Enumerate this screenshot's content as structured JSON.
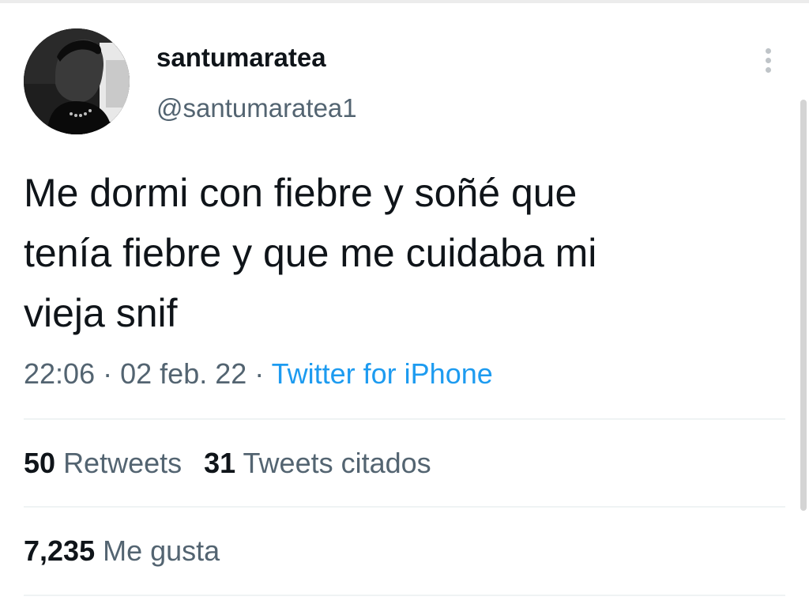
{
  "user": {
    "display_name": "santumaratea",
    "handle": "@santumaratea1"
  },
  "tweet": {
    "lines": [
      "Me dormi con fiebre y soñé que",
      "tenía fiebre y que me cuidaba mi",
      "vieja snif"
    ],
    "time": "22:06",
    "date": "02 feb. 22",
    "separator": "·",
    "source": "Twitter for iPhone"
  },
  "stats": {
    "retweets": {
      "count": "50",
      "label": "Retweets"
    },
    "quotes": {
      "count": "31",
      "label": "Tweets citados"
    },
    "likes": {
      "count": "7,235",
      "label": "Me gusta"
    }
  },
  "icons": {
    "more": "more-vertical-icon"
  },
  "colors": {
    "text": "#0f1419",
    "secondary": "#536471",
    "link": "#1d9bf0",
    "divider": "#eff3f4"
  }
}
